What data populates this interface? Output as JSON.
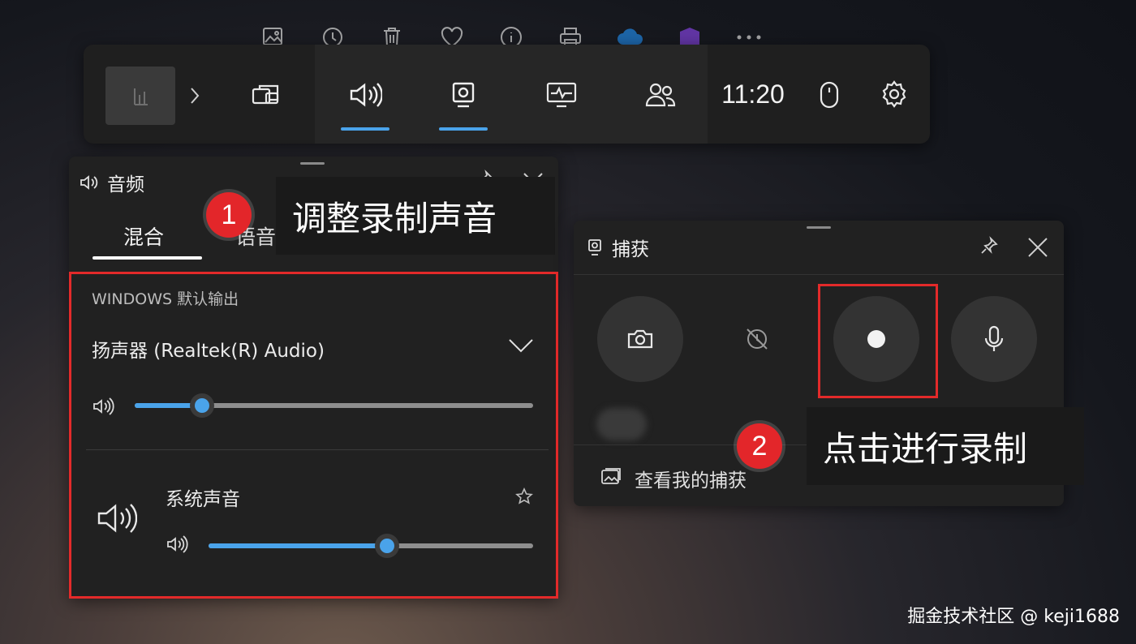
{
  "top_strip_icons": [
    "image-edit-icon",
    "history-icon",
    "trash-icon",
    "heart-icon",
    "info-icon",
    "printer-icon",
    "cloud-icon",
    "app-icon",
    "more-icon"
  ],
  "game_bar": {
    "clock": "11:20",
    "widgets": [
      "widget-thumbnail",
      "chevron-right-icon",
      "multitask-icon",
      "audio-icon",
      "capture-icon",
      "performance-icon",
      "social-icon"
    ],
    "active_tab_color": "#4aa3ea"
  },
  "audio_panel": {
    "title": "音频",
    "tabs": [
      "混合",
      "语音"
    ],
    "section_label": "WINDOWS 默认输出",
    "device": "扬声器 (Realtek(R) Audio)",
    "master_volume": 0.17,
    "app_name": "系统声音",
    "app_volume": 0.55
  },
  "capture_panel": {
    "title": "捕获",
    "view_captures": "查看我的捕获"
  },
  "callouts": {
    "one": {
      "number": "1",
      "text": "调整录制声音"
    },
    "two": {
      "number": "2",
      "text": "点击进行录制"
    }
  },
  "watermark": "掘金技术社区 @ keji1688",
  "colors": {
    "accent": "#4aa3ea",
    "highlight": "#e32a2a",
    "badge": "#e3262a"
  }
}
